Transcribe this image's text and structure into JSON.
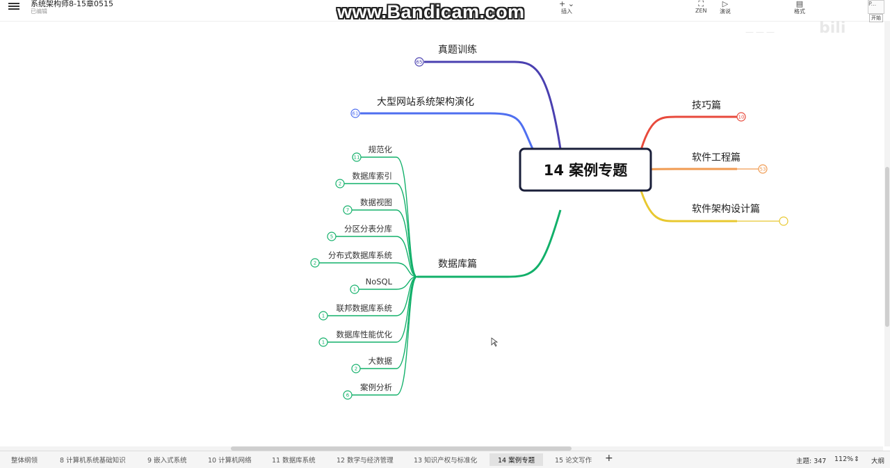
{
  "header": {
    "doc_title": "系统架构师8-15章0515",
    "doc_status": "已编辑",
    "toolbar": [
      {
        "key": "zen",
        "label": "ZEN",
        "icon": "⛶"
      },
      {
        "key": "present",
        "label": "演说",
        "icon": "▷"
      },
      {
        "key": "format",
        "label": "格式",
        "icon": "▤"
      },
      {
        "key": "insert",
        "label": "插入",
        "icon": "+ ⌄"
      }
    ],
    "start_label": "开始",
    "avatar_label": "P..."
  },
  "watermark": "www.Bandicam.com",
  "mindmap": {
    "root": "14 案例专题",
    "left_top": [
      {
        "label": "真题训练",
        "count": "65",
        "color": "#4a40b0"
      },
      {
        "label": "大型网站系统架构演化",
        "count": "61",
        "color": "#4f6ff0"
      }
    ],
    "right": [
      {
        "label": "技巧篇",
        "count": "10",
        "color": "#e84a3c"
      },
      {
        "label": "软件工程篇",
        "count": "53",
        "color": "#f09a50"
      },
      {
        "label": "软件架构设计篇",
        "count": "",
        "color": "#e8c830"
      }
    ],
    "database": {
      "label": "数据库篇",
      "color": "#12b06a",
      "children": [
        {
          "label": "规范化",
          "count": "11"
        },
        {
          "label": "数据库索引",
          "count": "2"
        },
        {
          "label": "数据视图",
          "count": "7"
        },
        {
          "label": "分区分表分库",
          "count": "5"
        },
        {
          "label": "分布式数据库系统",
          "count": "2"
        },
        {
          "label": "NoSQL",
          "count": "1"
        },
        {
          "label": "联邦数据库系统",
          "count": "1"
        },
        {
          "label": "数据库性能优化",
          "count": "1"
        },
        {
          "label": "大数据",
          "count": "2"
        },
        {
          "label": "案例分析",
          "count": "6"
        }
      ]
    }
  },
  "tabs": [
    {
      "label": "整体纲领",
      "active": false
    },
    {
      "label": "8 计算机系统基础知识",
      "active": false
    },
    {
      "label": "9 嵌入式系统",
      "active": false
    },
    {
      "label": "10 计算机网络",
      "active": false
    },
    {
      "label": "11 数据库系统",
      "active": false
    },
    {
      "label": "12 数学与经济管理",
      "active": false
    },
    {
      "label": "13 知识产权与标准化",
      "active": false
    },
    {
      "label": "14 案例专题",
      "active": true
    },
    {
      "label": "15 论文写作",
      "active": false
    }
  ],
  "status": {
    "topic_count": "主题: 347",
    "zoom": "112%",
    "outline_size": "大纲"
  }
}
